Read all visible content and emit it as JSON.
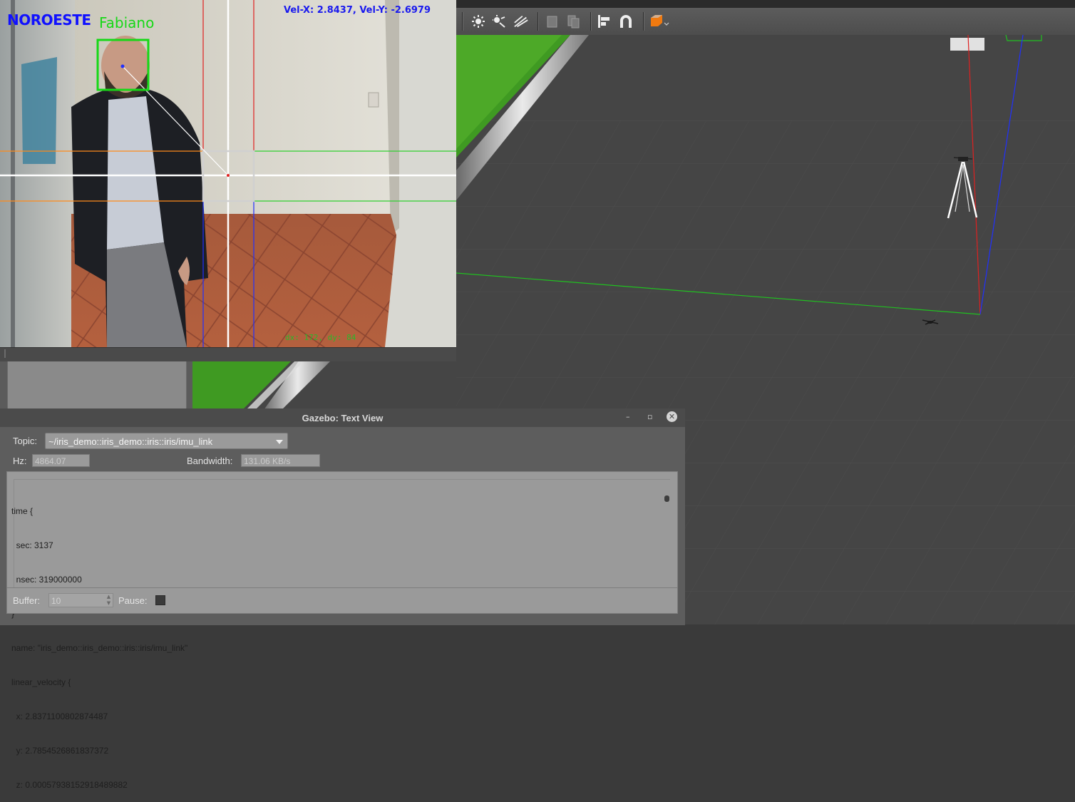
{
  "camera": {
    "direction_label": "NOROESTE",
    "person_name": "Fabiano",
    "velocity_text": "Vel-X: 2.8437, Vel-Y: -2.6979",
    "delta_text": "dx: 172, dy: 84"
  },
  "toolbar": {
    "icons": [
      "sun-light-icon",
      "point-light-icon",
      "spot-light-icon",
      "copy-icon",
      "paste-icon",
      "align-icon",
      "snap-magnet-icon",
      "view-angle-icon"
    ]
  },
  "text_view": {
    "title": "Gazebo: Text View",
    "topic_label": "Topic:",
    "topic_value": "~/iris_demo::iris_demo::iris::iris/imu_link",
    "hz_label": "Hz:",
    "hz_value": "4864.07",
    "bandwidth_label": "Bandwidth:",
    "bandwidth_value": "131.06 KB/s",
    "message_lines": [
      "time {",
      "  sec: 3137",
      "  nsec: 319000000",
      "}",
      "name: \"iris_demo::iris_demo::iris::iris/imu_link\"",
      "linear_velocity {",
      "  x: 2.8371100802874487",
      "  y: 2.7854526861837372",
      "  z: 0.00057938152918489882"
    ],
    "buffer_label": "Buffer:",
    "buffer_value": "10",
    "pause_label": "Pause:",
    "window_buttons": {
      "minimize": "–",
      "restore": "▫",
      "close": "✕"
    }
  },
  "colors": {
    "face_box": "#16d816",
    "direction_text": "#1010ff",
    "grass": "#3f9a22",
    "x_axis": "#e02020",
    "y_axis": "#20c020",
    "z_axis": "#2030ff"
  }
}
